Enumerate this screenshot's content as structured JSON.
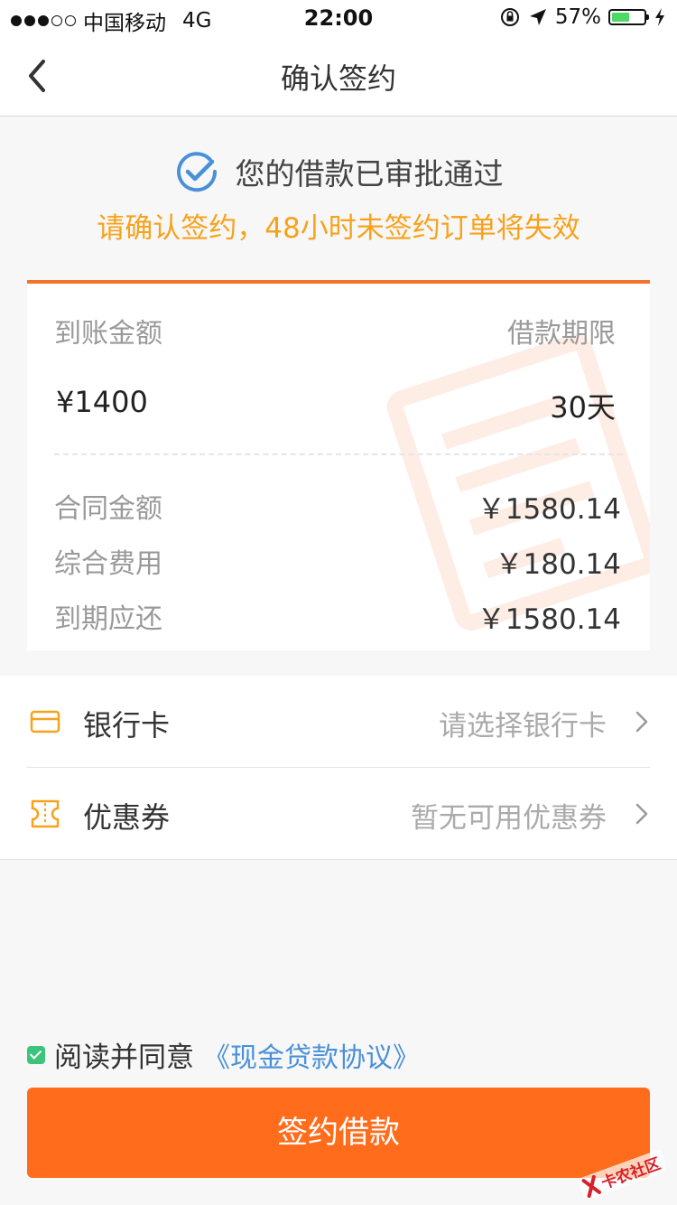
{
  "status_bar": {
    "carrier": "中国移动",
    "network": "4G",
    "time": "22:00",
    "battery_percent_text": "57%",
    "battery_level": 0.57
  },
  "nav": {
    "title": "确认签约"
  },
  "approval": {
    "message": "您的借款已审批通过",
    "warning": "请确认签约，48小时未签约订单将失效"
  },
  "loan": {
    "received_label": "到账金额",
    "received_amount": "¥1400",
    "term_label": "借款期限",
    "term_value": "30天",
    "details": [
      {
        "label": "合同金额",
        "value": "￥1580.14"
      },
      {
        "label": "综合费用",
        "value": "￥180.14"
      },
      {
        "label": "到期应还",
        "value": "￥1580.14"
      }
    ]
  },
  "options": {
    "bank_card": {
      "label": "银行卡",
      "value": "请选择银行卡",
      "icon": "bank-card-icon"
    },
    "coupon": {
      "label": "优惠券",
      "value": "暂无可用优惠券",
      "icon": "coupon-icon"
    }
  },
  "agreement": {
    "text": "阅读并同意",
    "link": "《现金贷款协议》",
    "checked": true
  },
  "submit": {
    "label": "签约借款"
  },
  "colors": {
    "accent": "#ff6d1c",
    "warning": "#f7a21b",
    "link": "#4a90d9",
    "check": "#3cc47c"
  },
  "watermark_logo": {
    "text": "卡农社区"
  }
}
